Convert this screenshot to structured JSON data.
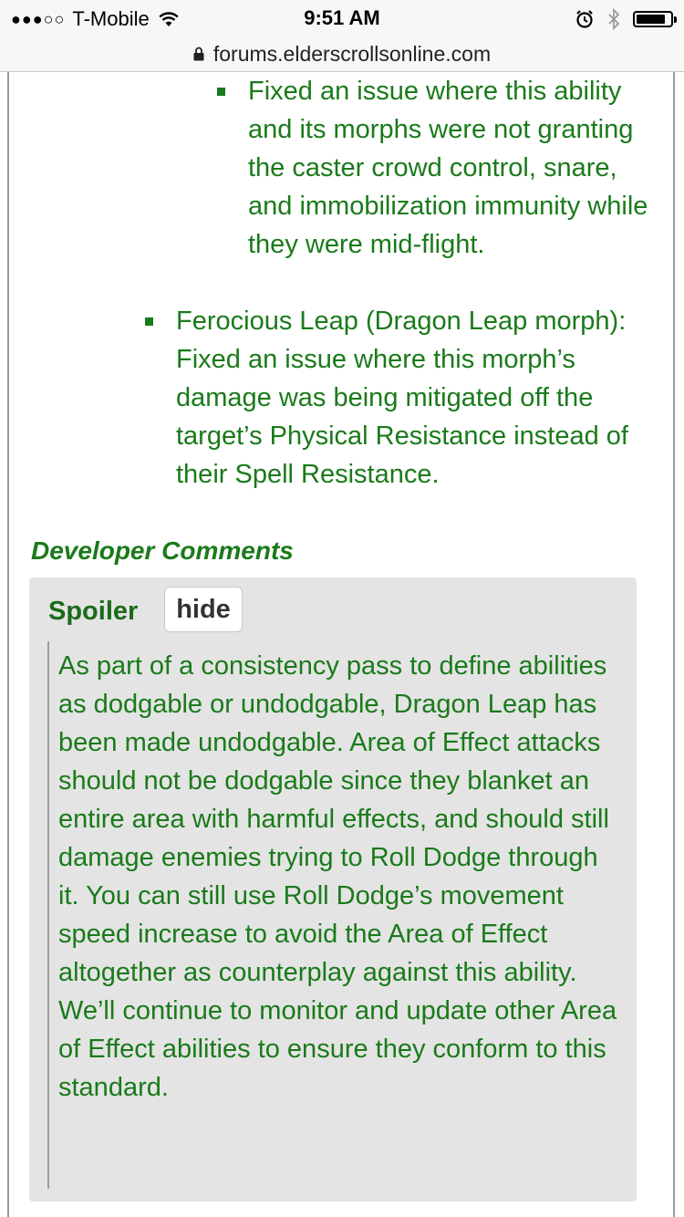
{
  "status_bar": {
    "signal_dots": "●●●○○",
    "carrier": "T-Mobile",
    "time": "9:51 AM",
    "battery_level": 0.85
  },
  "url_bar": {
    "url": "forums.elderscrollsonline.com"
  },
  "post": {
    "nested_bullet": "Fixed an issue where this ability and its morphs were not granting the caster crowd control, snare, and immobilization immunity while they were mid-flight.",
    "bullet": "Ferocious Leap (Dragon Leap morph): Fixed an issue where this morph’s damage was being mitigated off the target’s Physical Resistance instead of their Spell Resistance.",
    "developer_comments_heading": "Developer Comments",
    "spoiler": {
      "title": "Spoiler",
      "hide_label": "hide",
      "text": "As part of a consistency pass to define abilities as dodgable or undodgable, Dragon Leap has been made undodgable. Area of Effect attacks should not be dodgable since they blanket an entire area with harmful effects, and should still damage enemies trying to Roll Dodge through it. You can still use Roll Dodge’s movement speed increase to avoid the Area of Effect altogether as counterplay against this ability. We’ll continue to monitor and update other Area of Effect abilities to ensure they conform to this standard."
    }
  },
  "colors": {
    "text_green": "#1a7a1a",
    "spoiler_background": "#e4e4e4"
  },
  "icons": {
    "wifi": "wifi-icon",
    "alarm": "alarm-icon",
    "bluetooth": "bluetooth-icon",
    "battery": "battery-icon",
    "lock": "lock-icon",
    "bullet": "square-bullet-icon"
  }
}
